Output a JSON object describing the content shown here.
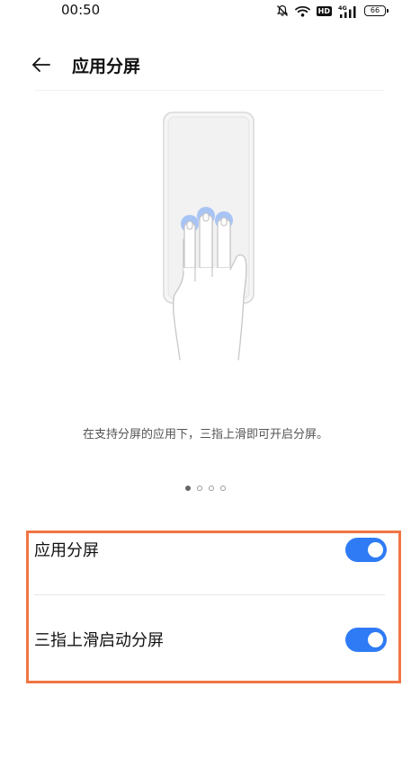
{
  "status_bar": {
    "time": "00:50",
    "icons": [
      "bell-off-icon",
      "wifi-icon",
      "hd-icon",
      "4g-signal-icon",
      "battery-icon"
    ],
    "hd_label": "HD",
    "network_label": "4G",
    "battery_level": "66"
  },
  "header": {
    "title": "应用分屏",
    "back_icon": "arrow-left-icon"
  },
  "illustration": {
    "caption": "在支持分屏的应用下，三指上滑即可开启分屏。",
    "page_count": 4,
    "active_page": 1
  },
  "settings": [
    {
      "label": "应用分屏",
      "enabled": true
    },
    {
      "label": "三指上滑启动分屏",
      "enabled": true
    }
  ],
  "colors": {
    "accent": "#2f7bf5",
    "highlight": "#f07545",
    "finger_tip": "#a8c4f5"
  }
}
